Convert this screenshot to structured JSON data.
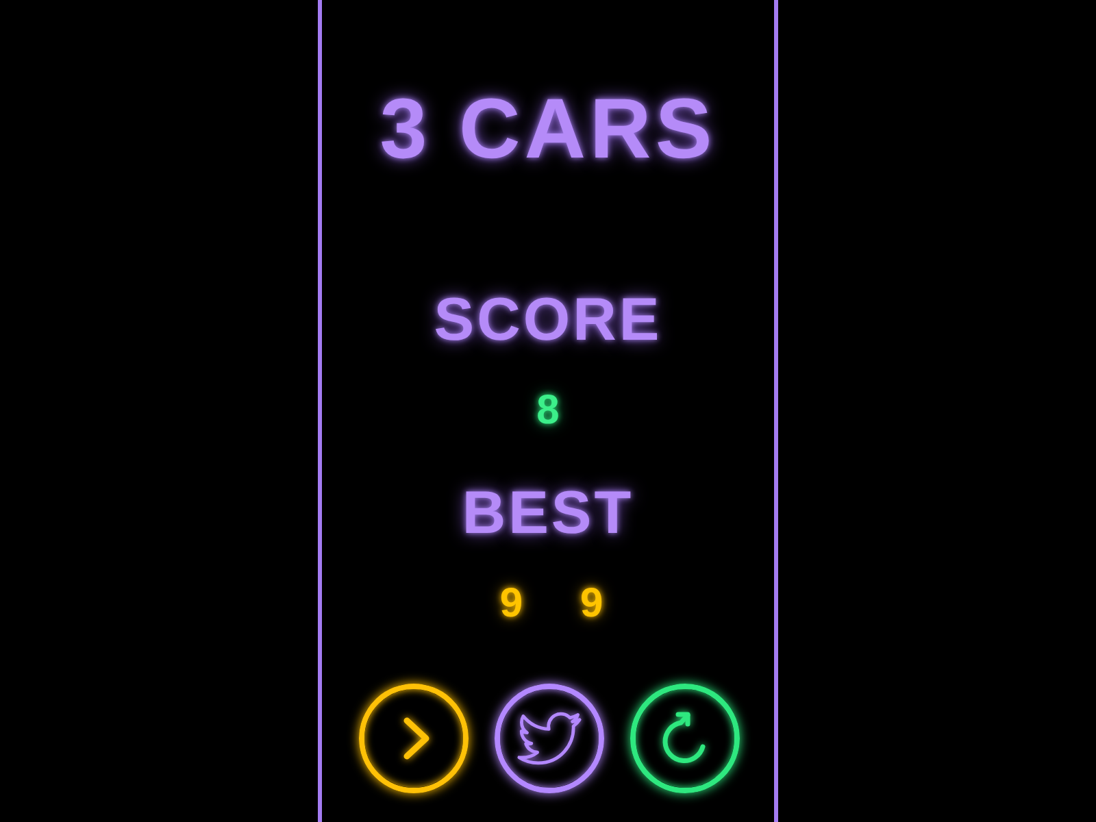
{
  "title": "3 CARS",
  "score": {
    "label": "SCORE",
    "value": "8"
  },
  "best": {
    "label": "BEST",
    "values": [
      "9",
      "9"
    ]
  },
  "buttons": [
    {
      "kind": "next",
      "color": "#ffc107"
    },
    {
      "kind": "twitter",
      "color": "#b388ff"
    },
    {
      "kind": "restart",
      "color": "#2ee87f"
    }
  ]
}
